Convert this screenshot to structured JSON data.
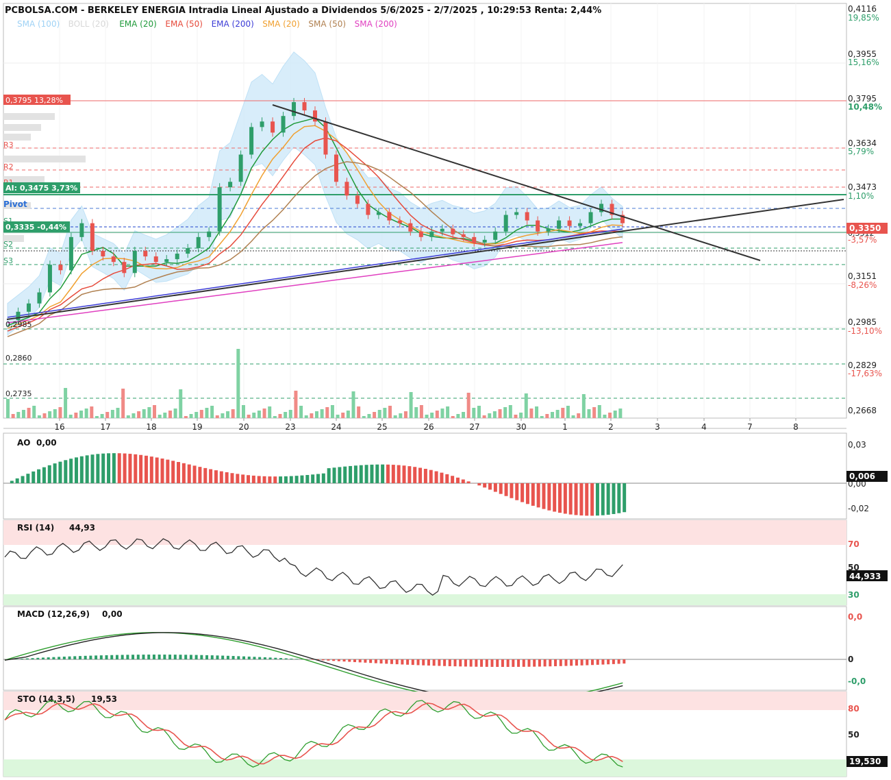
{
  "header": {
    "title": "PCBOLSA.COM - BERKELEY ENERGIA Intradia Lineal Ajustado a Dividendos 5/6/2025 - 2/7/2025 , 10:29:53 Renta: 2,44%"
  },
  "legend": [
    {
      "label": "SMA (100)",
      "color": "#9fd2f5"
    },
    {
      "label": "BOLL (20)",
      "color": "#d8d8d8"
    },
    {
      "label": "EMA (20)",
      "color": "#1f9a3a"
    },
    {
      "label": "EMA (50)",
      "color": "#e64a3b"
    },
    {
      "label": "EMA (200)",
      "color": "#3b3bd6"
    },
    {
      "label": "SMA (20)",
      "color": "#f0a030"
    },
    {
      "label": "SMA (50)",
      "color": "#b08050"
    },
    {
      "label": "SMA (200)",
      "color": "#e040c0"
    }
  ],
  "colors": {
    "up": "#2e9e6a",
    "down": "#e8544e",
    "band": "#d2ebfa"
  },
  "chart_data": [
    {
      "type": "candlestick",
      "title": "Precio",
      "x_labels": [
        "16",
        "17",
        "18",
        "19",
        "20",
        "23",
        "24",
        "25",
        "26",
        "27",
        "30",
        "1",
        "2",
        "3",
        "4",
        "7",
        "8"
      ],
      "close_series": [
        0.3,
        0.303,
        0.306,
        0.31,
        0.32,
        0.318,
        0.33,
        0.335,
        0.325,
        0.323,
        0.321,
        0.317,
        0.325,
        0.323,
        0.321,
        0.322,
        0.324,
        0.326,
        0.33,
        0.332,
        0.348,
        0.35,
        0.36,
        0.37,
        0.372,
        0.368,
        0.374,
        0.379,
        0.376,
        0.372,
        0.36,
        0.35,
        0.345,
        0.342,
        0.338,
        0.339,
        0.336,
        0.335,
        0.332,
        0.33,
        0.332,
        0.333,
        0.331,
        0.33,
        0.328,
        0.329,
        0.332,
        0.338,
        0.339,
        0.336,
        0.332,
        0.333,
        0.336,
        0.334,
        0.335,
        0.339,
        0.342,
        0.338,
        0.335
      ],
      "y_ticks": [
        "0,4116",
        "0,3955",
        "0,3795",
        "0,3634",
        "0,3473",
        "0,3312",
        "0,3151",
        "0,2985",
        "0,2829",
        "0,2668"
      ],
      "pct_ticks": [
        "19,85%",
        "15,16%",
        "10,48%",
        "5,79%",
        "1,10%",
        "-3,57%",
        "-8,26%",
        "-13,10%",
        "-17,63%"
      ],
      "last_price": "0,3350",
      "levels": {
        "high": "0,3795  13,28%",
        "ai": "AI: 0,3475  3,73%",
        "s1": "0,3335  -0,44%",
        "pivot": "Pivot",
        "r3": "R3",
        "r2": "R2",
        "r1": "R1",
        "s1_label": "S1",
        "s2": "S2",
        "s3": "S3"
      },
      "volume_labels": [
        "0,2985",
        "0,2860",
        "0,2735"
      ]
    },
    {
      "type": "bar",
      "title": "AO",
      "value": "0,00",
      "last": "0,006",
      "y_ticks": [
        "0,03",
        "0,00",
        "-0,02"
      ]
    },
    {
      "type": "line",
      "title": "RSI (14)",
      "value": "44,93",
      "last": "44,933",
      "y_ticks": [
        "70",
        "50",
        "30"
      ]
    },
    {
      "type": "line",
      "title": "MACD (12,26,9)",
      "value": "0,00",
      "y_ticks": [
        "0,0",
        "0",
        "-0,0"
      ]
    },
    {
      "type": "line",
      "title": "STO (14,3,5)",
      "value": "19,53",
      "last": "19,530",
      "y_ticks": [
        "80",
        "50"
      ]
    }
  ]
}
